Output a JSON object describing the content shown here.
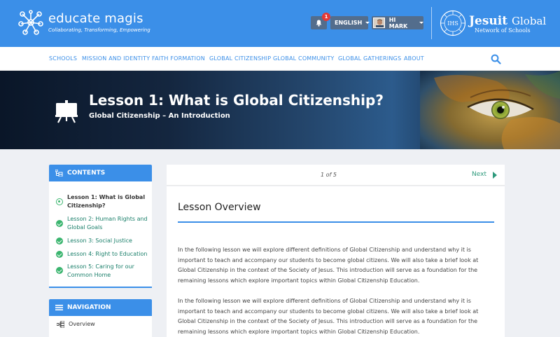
{
  "header": {
    "brand": "educate magis",
    "tagline": "Collaborating, Transforming, Empowering",
    "notification_count": "1",
    "language": "ENGLISH",
    "greeting": "HI MARK",
    "partner_title": "Jesuit",
    "partner_title_suffix": "Global",
    "partner_subtitle": "Network of Schools",
    "seal_text": "IHS"
  },
  "nav": {
    "items": [
      "SCHOOLS",
      "MISSION AND IDENTITY",
      "FAITH FORMATION",
      "GLOBAL CITIZENSHIP",
      "GLOBAL COMMUNITY",
      "GLOBAL GATHERINGS",
      "ABOUT"
    ]
  },
  "hero": {
    "title": "Lesson 1: What is Global Citizenship?",
    "subtitle": "Global Citizenship – An Introduction"
  },
  "sidebar": {
    "contents_label": "CONTENTS",
    "lessons": [
      {
        "label": "Lesson 1: What is Global Citizenship?",
        "status": "current"
      },
      {
        "label": "Lesson 2: Human Rights and Global Goals",
        "status": "complete"
      },
      {
        "label": "Lesson 3: Social Justice",
        "status": "complete"
      },
      {
        "label": "Lesson 4: Right to Education",
        "status": "complete"
      },
      {
        "label": "Lesson 5: Caring for our Common Home",
        "status": "complete"
      }
    ],
    "navigation_label": "NAVIGATION",
    "navigation_items": [
      "Overview"
    ]
  },
  "pager": {
    "page_indicator": "1 of 5",
    "next_label": "Next"
  },
  "content": {
    "heading": "Lesson Overview",
    "paragraphs": [
      "In the following lesson we will explore different definitions of Global Citizenship and understand why it is important to teach and accompany our students to become global citizens. We will also take a brief look at Global Citizenship in the context of the Society of Jesus. This introduction will serve as a foundation for the remaining lessons which explore important topics within Global Citizenship Education.",
      "In the following lesson we will explore different definitions of Global Citizenship and understand why it is important to teach and accompany our students to become global citizens. We will also take a brief look at Global Citizenship in the context of the Society of Jesus. This introduction will serve as a foundation for the remaining lessons which explore important topics within Global Citizenship Education."
    ]
  },
  "colors": {
    "primary": "#3b8fe8",
    "success": "#3bb56f",
    "link_green": "#2e9a7c",
    "badge": "#e53935"
  }
}
